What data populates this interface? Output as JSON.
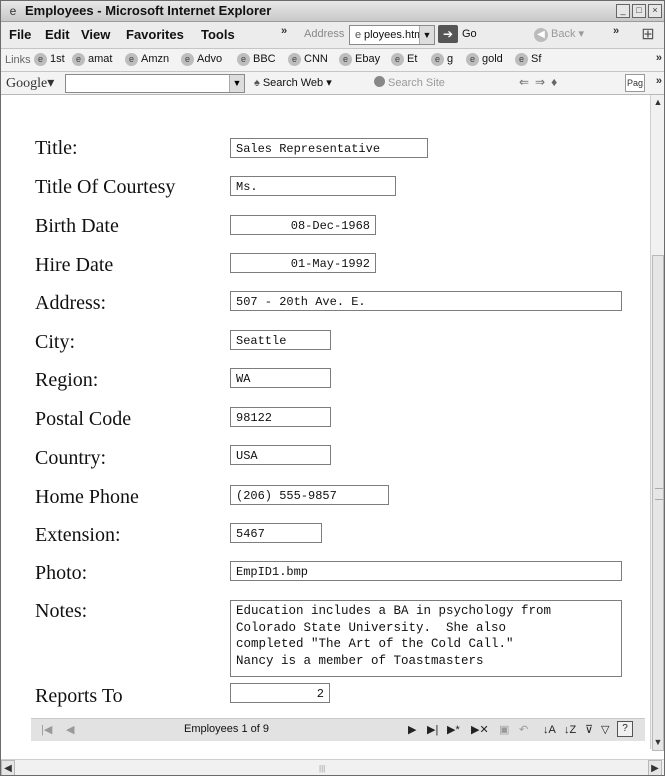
{
  "window": {
    "title": "Employees - Microsoft Internet Explorer"
  },
  "menu": [
    "File",
    "Edit",
    "View",
    "Favorites",
    "Tools"
  ],
  "address": {
    "label": "Address",
    "value": "ployees.htm",
    "go_label": "Go",
    "back_label": "Back"
  },
  "links": {
    "label": "Links",
    "items": [
      "1st",
      "amat",
      "Amzn",
      "Advo",
      "BBC",
      "CNN",
      "Ebay",
      "Et",
      "g",
      "gold",
      "Sf"
    ]
  },
  "google": {
    "logo": "Google",
    "search_web": "Search Web",
    "search_site": "Search Site",
    "page_label": "Pag"
  },
  "form": {
    "fields": [
      {
        "label": "Title:",
        "value": "Sales Representative"
      },
      {
        "label": "Title Of Courtesy",
        "value": "Ms."
      },
      {
        "label": "Birth Date",
        "value": "08-Dec-1968"
      },
      {
        "label": "Hire Date",
        "value": "01-May-1992"
      },
      {
        "label": "Address:",
        "value": "507 - 20th Ave. E."
      },
      {
        "label": "City:",
        "value": "Seattle"
      },
      {
        "label": "Region:",
        "value": "WA"
      },
      {
        "label": "Postal Code",
        "value": "98122"
      },
      {
        "label": "Country:",
        "value": "USA"
      },
      {
        "label": "Home Phone",
        "value": "(206) 555-9857"
      },
      {
        "label": "Extension:",
        "value": "5467"
      },
      {
        "label": "Photo:",
        "value": "EmpID1.bmp"
      }
    ],
    "notes": {
      "label": "Notes:",
      "value": "Education includes a BA in psychology from\nColorado State University.  She also\ncompleted \"The Art of the Cold Call.\"\nNancy is a member of Toastmasters"
    },
    "reports_to": {
      "label": "Reports To",
      "value": "2"
    }
  },
  "navigation": {
    "record_label": "Employees 1 of 9"
  }
}
